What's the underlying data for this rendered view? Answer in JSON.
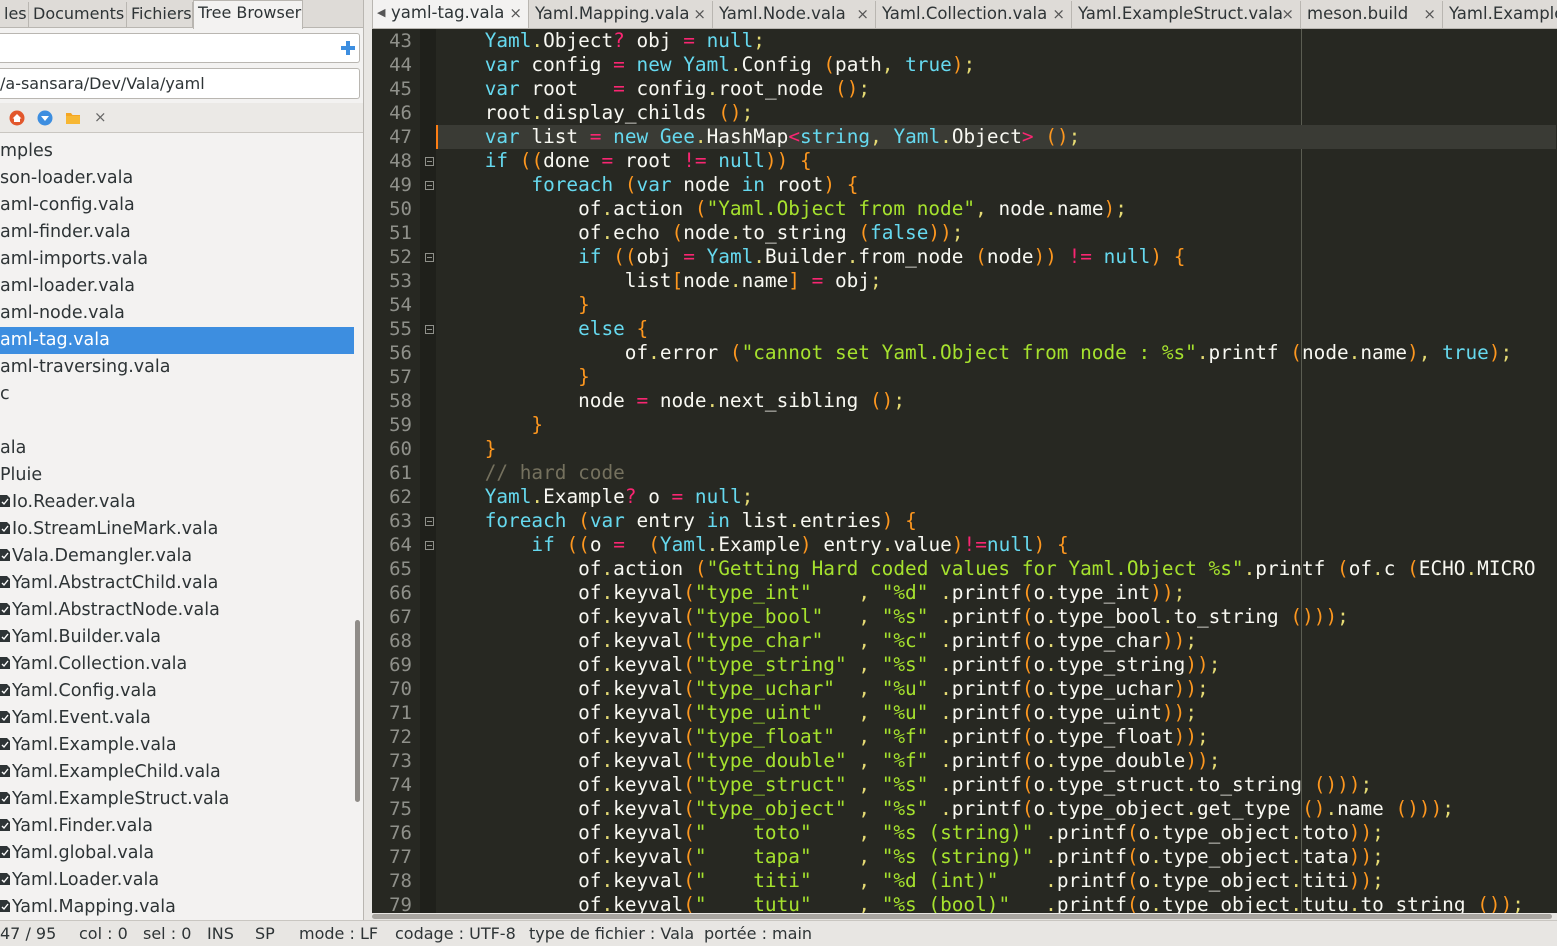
{
  "sidebar": {
    "tabs": [
      {
        "label": "les"
      },
      {
        "label": "Documents"
      },
      {
        "label": "Fichiers"
      },
      {
        "label": "Tree Browser"
      }
    ],
    "filter_value": "",
    "path_value": "/a-sansara/Dev/Vala/yaml",
    "toolbar_icons": [
      "home-icon",
      "go-down-icon",
      "folder-icon",
      "close-icon"
    ],
    "tree": [
      {
        "label": "mples"
      },
      {
        "label": "son-loader.vala"
      },
      {
        "label": "aml-config.vala"
      },
      {
        "label": "aml-finder.vala"
      },
      {
        "label": "aml-imports.vala"
      },
      {
        "label": "aml-loader.vala"
      },
      {
        "label": "aml-node.vala"
      },
      {
        "label": "aml-tag.vala",
        "selected": true
      },
      {
        "label": "aml-traversing.vala"
      },
      {
        "label": "c"
      },
      {
        "label": ""
      },
      {
        "label": "ala"
      },
      {
        "label": "Pluie"
      },
      {
        "label": "Io.Reader.vala",
        "file": true
      },
      {
        "label": "Io.StreamLineMark.vala",
        "file": true
      },
      {
        "label": "Vala.Demangler.vala",
        "file": true
      },
      {
        "label": "Yaml.AbstractChild.vala",
        "file": true
      },
      {
        "label": "Yaml.AbstractNode.vala",
        "file": true
      },
      {
        "label": "Yaml.Builder.vala",
        "file": true
      },
      {
        "label": "Yaml.Collection.vala",
        "file": true
      },
      {
        "label": "Yaml.Config.vala",
        "file": true
      },
      {
        "label": "Yaml.Event.vala",
        "file": true
      },
      {
        "label": "Yaml.Example.vala",
        "file": true
      },
      {
        "label": "Yaml.ExampleChild.vala",
        "file": true
      },
      {
        "label": "Yaml.ExampleStruct.vala",
        "file": true
      },
      {
        "label": "Yaml.Finder.vala",
        "file": true
      },
      {
        "label": "Yaml.global.vala",
        "file": true
      },
      {
        "label": "Yaml.Loader.vala",
        "file": true
      },
      {
        "label": "Yaml.Mapping.vala",
        "file": true
      }
    ]
  },
  "editor": {
    "tabs": [
      {
        "label": "yaml-tag.vala",
        "active": true
      },
      {
        "label": "Yaml.Mapping.vala"
      },
      {
        "label": "Yaml.Node.vala"
      },
      {
        "label": "Yaml.Collection.vala"
      },
      {
        "label": "Yaml.ExampleStruct.vala"
      },
      {
        "label": "meson.build"
      },
      {
        "label": "Yaml.Example"
      }
    ],
    "close_glyph": "×",
    "current_line": 47,
    "lines": [
      {
        "n": "43",
        "code": "    Yaml.Object? obj = null;"
      },
      {
        "n": "44",
        "code": "    var config = new Yaml.Config (path, true);"
      },
      {
        "n": "45",
        "code": "    var root   = config.root_node ();"
      },
      {
        "n": "46",
        "code": "    root.display_childs ();"
      },
      {
        "n": "47",
        "code": "    var list = new Gee.HashMap<string, Yaml.Object> ();"
      },
      {
        "n": "48",
        "code": "    if ((done = root != null)) {",
        "fold": true
      },
      {
        "n": "49",
        "code": "        foreach (var node in root) {",
        "fold": true
      },
      {
        "n": "50",
        "code": "            of.action (\"Yaml.Object from node\", node.name);"
      },
      {
        "n": "51",
        "code": "            of.echo (node.to_string (false));"
      },
      {
        "n": "52",
        "code": "            if ((obj = Yaml.Builder.from_node (node)) != null) {",
        "fold": true
      },
      {
        "n": "53",
        "code": "                list[node.name] = obj;"
      },
      {
        "n": "54",
        "code": "            }"
      },
      {
        "n": "55",
        "code": "            else {",
        "fold": true
      },
      {
        "n": "56",
        "code": "                of.error (\"cannot set Yaml.Object from node : %s\".printf (node.name), true);"
      },
      {
        "n": "57",
        "code": "            }"
      },
      {
        "n": "58",
        "code": "            node = node.next_sibling ();"
      },
      {
        "n": "59",
        "code": "        }"
      },
      {
        "n": "60",
        "code": "    }"
      },
      {
        "n": "61",
        "code": "    // hard code"
      },
      {
        "n": "62",
        "code": "    Yaml.Example? o = null;"
      },
      {
        "n": "63",
        "code": "    foreach (var entry in list.entries) {",
        "fold": true
      },
      {
        "n": "64",
        "code": "        if ((o =  (Yaml.Example) entry.value)!=null) {",
        "fold": true
      },
      {
        "n": "65",
        "code": "            of.action (\"Getting Hard coded values for Yaml.Object %s\".printf (of.c (ECHO.MICRO"
      },
      {
        "n": "66",
        "code": "            of.keyval(\"type_int\"    , \"%d\" .printf(o.type_int));"
      },
      {
        "n": "67",
        "code": "            of.keyval(\"type_bool\"   , \"%s\" .printf(o.type_bool.to_string ()));"
      },
      {
        "n": "68",
        "code": "            of.keyval(\"type_char\"   , \"%c\" .printf(o.type_char));"
      },
      {
        "n": "69",
        "code": "            of.keyval(\"type_string\" , \"%s\" .printf(o.type_string));"
      },
      {
        "n": "70",
        "code": "            of.keyval(\"type_uchar\"  , \"%u\" .printf(o.type_uchar));"
      },
      {
        "n": "71",
        "code": "            of.keyval(\"type_uint\"   , \"%u\" .printf(o.type_uint));"
      },
      {
        "n": "72",
        "code": "            of.keyval(\"type_float\"  , \"%f\" .printf(o.type_float));"
      },
      {
        "n": "73",
        "code": "            of.keyval(\"type_double\" , \"%f\" .printf(o.type_double));"
      },
      {
        "n": "74",
        "code": "            of.keyval(\"type_struct\" , \"%s\" .printf(o.type_struct.to_string ()));"
      },
      {
        "n": "75",
        "code": "            of.keyval(\"type_object\" , \"%s\" .printf(o.type_object.get_type ().name ()));"
      },
      {
        "n": "76",
        "code": "            of.keyval(\"    toto\"    , \"%s (string)\" .printf(o.type_object.toto));"
      },
      {
        "n": "77",
        "code": "            of.keyval(\"    tapa\"    , \"%s (string)\" .printf(o.type_object.tata));"
      },
      {
        "n": "78",
        "code": "            of.keyval(\"    titi\"    , \"%d (int)\"    .printf(o.type_object.titi));"
      },
      {
        "n": "79",
        "code": "            of.keyval(\"    tutu\"    , \"%s (bool)\"   .printf(o.type_object.tutu.to_string ());"
      }
    ]
  },
  "statusbar": {
    "line": "47 / 95",
    "col": "col : 0",
    "sel": "sel : 0",
    "ins": "INS",
    "sp": "SP",
    "mode": "mode : LF",
    "encoding": "codage : UTF-8",
    "filetype": "type de fichier : Vala",
    "scope": "portée : main"
  },
  "colors": {
    "editor_bg": "#272822",
    "keyword": "#66d9ef",
    "string": "#a6e22e",
    "operator": "#f92672",
    "bracket": "#fd971f",
    "comment": "#75715e",
    "selection": "#3d8ee0",
    "current_line_marker": "#fd7e14"
  }
}
